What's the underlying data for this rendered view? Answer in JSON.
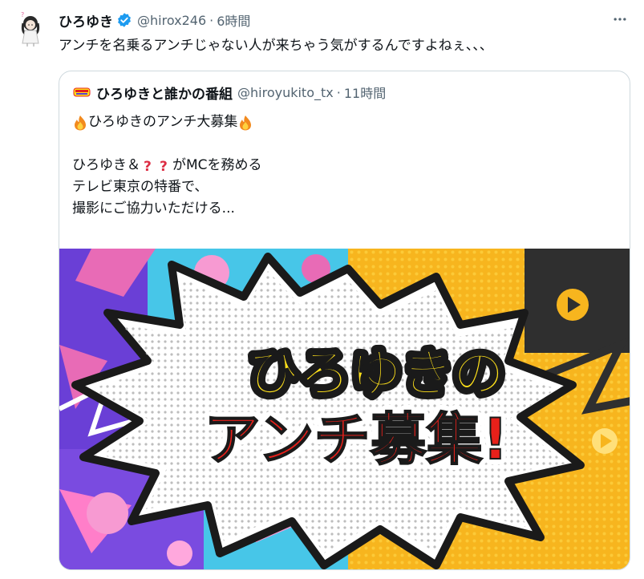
{
  "tweet": {
    "display_name": "ひろゆき",
    "handle": "@hirox246",
    "dot": "·",
    "time": "6時間",
    "text": "アンチを名乗るアンチじゃない人が来ちゃう気がするんですよねぇ、、、"
  },
  "quote": {
    "display_name": "ひろゆきと誰かの番組",
    "handle": "@hiroyukito_tx",
    "dot": "·",
    "time": "11時間",
    "line1": "ひろゆきのアンチ大募集",
    "line3_a": "ひろゆき＆",
    "line3_b": "がMCを務める",
    "line4": "テレビ東京の特番で、",
    "line5": "撮影にご協力いただける..."
  },
  "media": {
    "headline_top": "ひろゆきの",
    "headline_bottom": "アンチ募集!"
  },
  "icons": {
    "verified": "verified-badge-icon",
    "more": "more-horizontal-icon",
    "fire": "fire-emoji-icon",
    "question": "red-question-mark-icon"
  },
  "colors": {
    "text": "#0f1419",
    "secondary": "#536471",
    "verified": "#1d9bf0",
    "border": "#cfd9de",
    "headline_yellow": "#ffe11a",
    "headline_red": "#e8201a"
  }
}
